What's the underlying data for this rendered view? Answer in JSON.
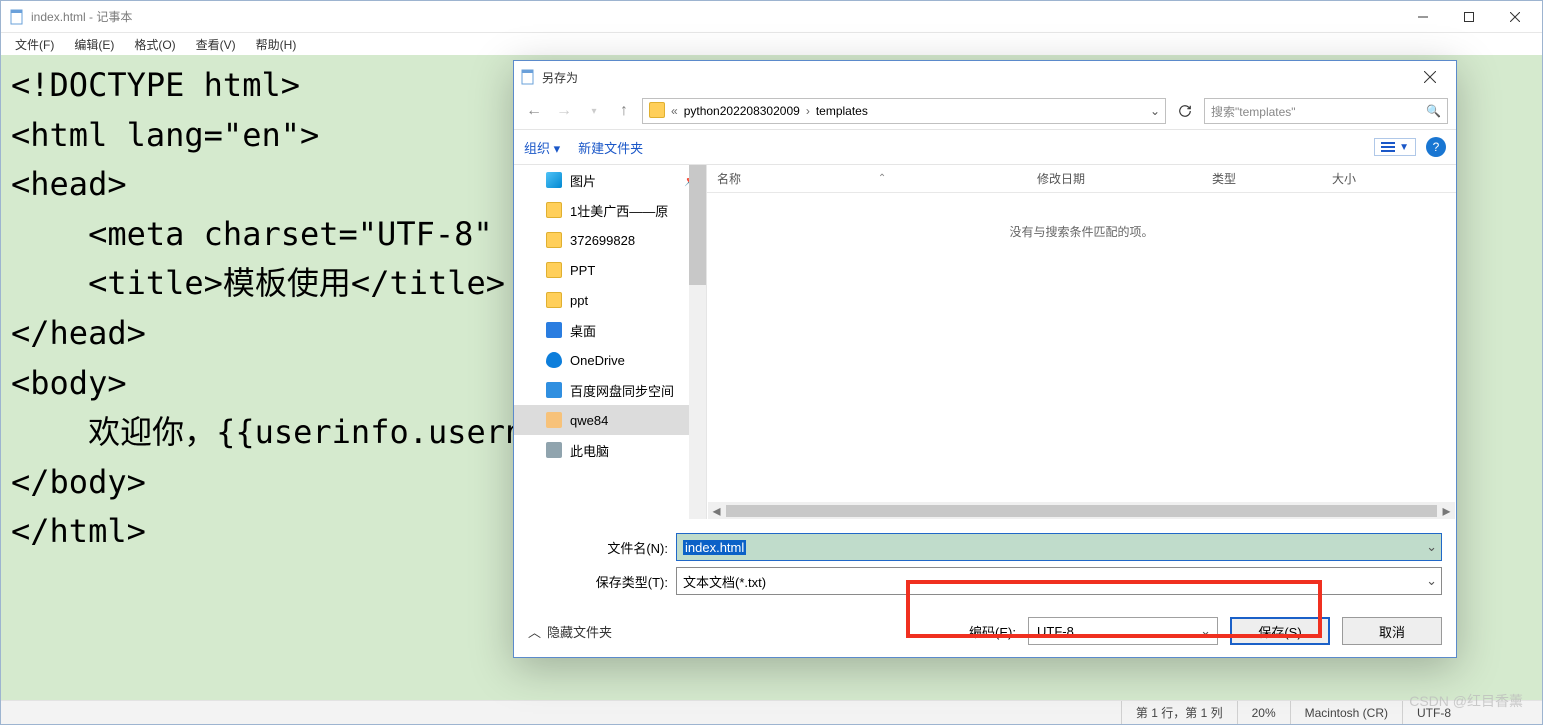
{
  "notepad": {
    "title": "index.html - 记事本",
    "menus": {
      "file": "文件(F)",
      "edit": "编辑(E)",
      "format": "格式(O)",
      "view": "查看(V)",
      "help": "帮助(H)"
    },
    "content": "<!DOCTYPE html>\n<html lang=\"en\">\n<head>\n    <meta charset=\"UTF-8\"\n    <title>模板使用</title>\n</head>\n<body>\n    欢迎你，{{userinfo.usern\n</body>\n</html>",
    "status": {
      "pos": "第 1 行，第 1 列",
      "zoom": "20%",
      "eol": "Macintosh (CR)",
      "encoding": "UTF-8"
    }
  },
  "saveas": {
    "title": "另存为",
    "breadcrumb": {
      "seg1": "python202208302009",
      "seg2": "templates"
    },
    "search_placeholder": "搜索\"templates\"",
    "toolbar": {
      "organize": "组织",
      "newfolder": "新建文件夹"
    },
    "columns": {
      "name": "名称",
      "date": "修改日期",
      "type": "类型",
      "size": "大小"
    },
    "empty": "没有与搜索条件匹配的项。",
    "sidebar": {
      "items": [
        {
          "label": "图片",
          "icon": "pic",
          "pinned": true
        },
        {
          "label": "1壮美广西——原",
          "icon": "folder"
        },
        {
          "label": "372699828",
          "icon": "folder"
        },
        {
          "label": "PPT",
          "icon": "folder"
        },
        {
          "label": "ppt",
          "icon": "folder"
        },
        {
          "label": "桌面",
          "icon": "desk"
        },
        {
          "label": "OneDrive",
          "icon": "cloud"
        },
        {
          "label": "百度网盘同步空间",
          "icon": "bdp"
        },
        {
          "label": "qwe84",
          "icon": "user",
          "selected": true
        },
        {
          "label": "此电脑",
          "icon": "pc"
        }
      ]
    },
    "form": {
      "filename_label": "文件名(N):",
      "filename_value": "index.html",
      "filetype_label": "保存类型(T):",
      "filetype_value": "文本文档(*.txt)",
      "encoding_label": "编码(E):",
      "encoding_value": "UTF-8",
      "hide_folders": "隐藏文件夹",
      "save": "保存(S)",
      "cancel": "取消"
    }
  },
  "watermark": "CSDN @红目香薰"
}
